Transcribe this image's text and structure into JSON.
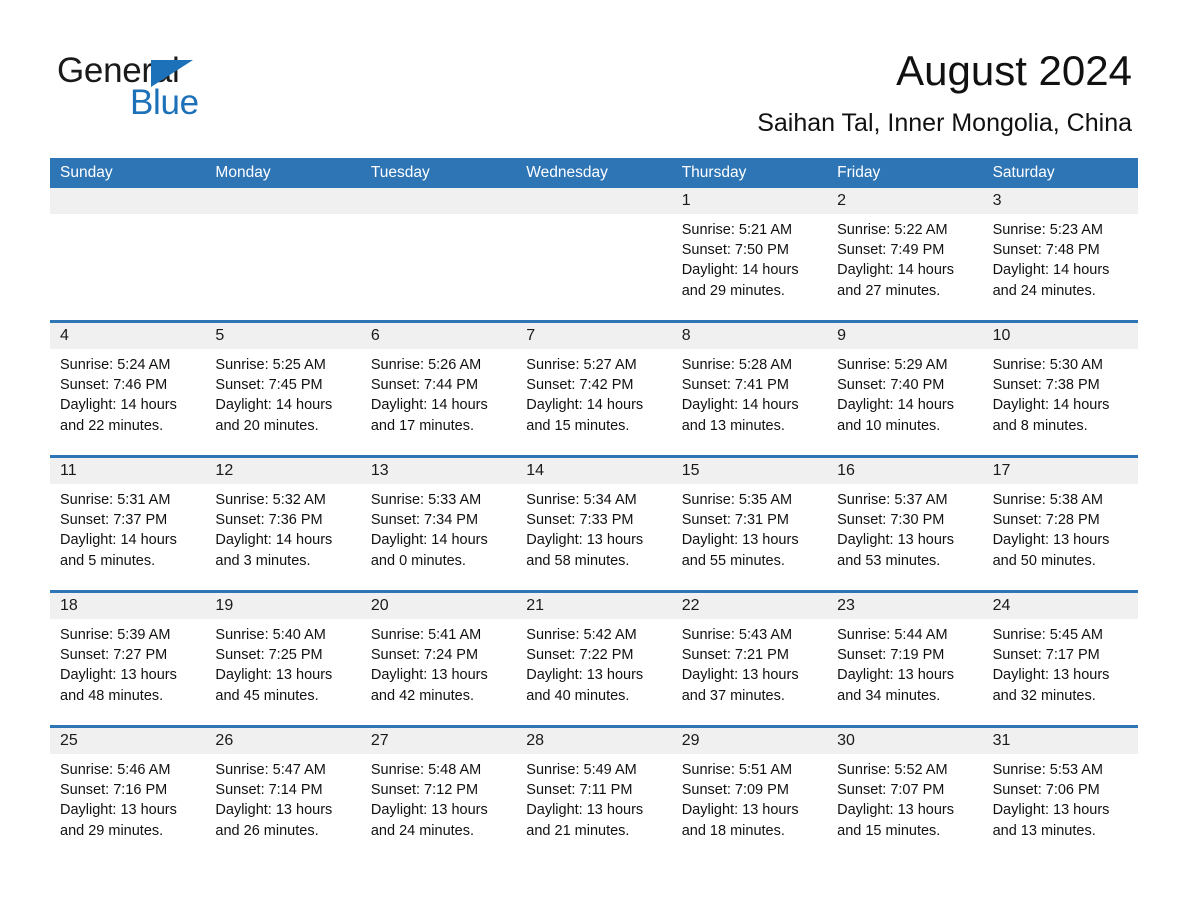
{
  "brand": {
    "name_part1": "General",
    "name_part2": "Blue",
    "triangle_color": "#1c71b8"
  },
  "header": {
    "month_title": "August 2024",
    "location": "Saihan Tal, Inner Mongolia, China"
  },
  "colors": {
    "header_blue": "#2e75b6",
    "day_band_gray": "#f0f0f0",
    "text": "#111111"
  },
  "weekdays": [
    "Sunday",
    "Monday",
    "Tuesday",
    "Wednesday",
    "Thursday",
    "Friday",
    "Saturday"
  ],
  "weeks": [
    [
      {
        "day": "",
        "lines": []
      },
      {
        "day": "",
        "lines": []
      },
      {
        "day": "",
        "lines": []
      },
      {
        "day": "",
        "lines": []
      },
      {
        "day": "1",
        "lines": [
          "Sunrise: 5:21 AM",
          "Sunset: 7:50 PM",
          "Daylight: 14 hours",
          "and 29 minutes."
        ]
      },
      {
        "day": "2",
        "lines": [
          "Sunrise: 5:22 AM",
          "Sunset: 7:49 PM",
          "Daylight: 14 hours",
          "and 27 minutes."
        ]
      },
      {
        "day": "3",
        "lines": [
          "Sunrise: 5:23 AM",
          "Sunset: 7:48 PM",
          "Daylight: 14 hours",
          "and 24 minutes."
        ]
      }
    ],
    [
      {
        "day": "4",
        "lines": [
          "Sunrise: 5:24 AM",
          "Sunset: 7:46 PM",
          "Daylight: 14 hours",
          "and 22 minutes."
        ]
      },
      {
        "day": "5",
        "lines": [
          "Sunrise: 5:25 AM",
          "Sunset: 7:45 PM",
          "Daylight: 14 hours",
          "and 20 minutes."
        ]
      },
      {
        "day": "6",
        "lines": [
          "Sunrise: 5:26 AM",
          "Sunset: 7:44 PM",
          "Daylight: 14 hours",
          "and 17 minutes."
        ]
      },
      {
        "day": "7",
        "lines": [
          "Sunrise: 5:27 AM",
          "Sunset: 7:42 PM",
          "Daylight: 14 hours",
          "and 15 minutes."
        ]
      },
      {
        "day": "8",
        "lines": [
          "Sunrise: 5:28 AM",
          "Sunset: 7:41 PM",
          "Daylight: 14 hours",
          "and 13 minutes."
        ]
      },
      {
        "day": "9",
        "lines": [
          "Sunrise: 5:29 AM",
          "Sunset: 7:40 PM",
          "Daylight: 14 hours",
          "and 10 minutes."
        ]
      },
      {
        "day": "10",
        "lines": [
          "Sunrise: 5:30 AM",
          "Sunset: 7:38 PM",
          "Daylight: 14 hours",
          "and 8 minutes."
        ]
      }
    ],
    [
      {
        "day": "11",
        "lines": [
          "Sunrise: 5:31 AM",
          "Sunset: 7:37 PM",
          "Daylight: 14 hours",
          "and 5 minutes."
        ]
      },
      {
        "day": "12",
        "lines": [
          "Sunrise: 5:32 AM",
          "Sunset: 7:36 PM",
          "Daylight: 14 hours",
          "and 3 minutes."
        ]
      },
      {
        "day": "13",
        "lines": [
          "Sunrise: 5:33 AM",
          "Sunset: 7:34 PM",
          "Daylight: 14 hours",
          "and 0 minutes."
        ]
      },
      {
        "day": "14",
        "lines": [
          "Sunrise: 5:34 AM",
          "Sunset: 7:33 PM",
          "Daylight: 13 hours",
          "and 58 minutes."
        ]
      },
      {
        "day": "15",
        "lines": [
          "Sunrise: 5:35 AM",
          "Sunset: 7:31 PM",
          "Daylight: 13 hours",
          "and 55 minutes."
        ]
      },
      {
        "day": "16",
        "lines": [
          "Sunrise: 5:37 AM",
          "Sunset: 7:30 PM",
          "Daylight: 13 hours",
          "and 53 minutes."
        ]
      },
      {
        "day": "17",
        "lines": [
          "Sunrise: 5:38 AM",
          "Sunset: 7:28 PM",
          "Daylight: 13 hours",
          "and 50 minutes."
        ]
      }
    ],
    [
      {
        "day": "18",
        "lines": [
          "Sunrise: 5:39 AM",
          "Sunset: 7:27 PM",
          "Daylight: 13 hours",
          "and 48 minutes."
        ]
      },
      {
        "day": "19",
        "lines": [
          "Sunrise: 5:40 AM",
          "Sunset: 7:25 PM",
          "Daylight: 13 hours",
          "and 45 minutes."
        ]
      },
      {
        "day": "20",
        "lines": [
          "Sunrise: 5:41 AM",
          "Sunset: 7:24 PM",
          "Daylight: 13 hours",
          "and 42 minutes."
        ]
      },
      {
        "day": "21",
        "lines": [
          "Sunrise: 5:42 AM",
          "Sunset: 7:22 PM",
          "Daylight: 13 hours",
          "and 40 minutes."
        ]
      },
      {
        "day": "22",
        "lines": [
          "Sunrise: 5:43 AM",
          "Sunset: 7:21 PM",
          "Daylight: 13 hours",
          "and 37 minutes."
        ]
      },
      {
        "day": "23",
        "lines": [
          "Sunrise: 5:44 AM",
          "Sunset: 7:19 PM",
          "Daylight: 13 hours",
          "and 34 minutes."
        ]
      },
      {
        "day": "24",
        "lines": [
          "Sunrise: 5:45 AM",
          "Sunset: 7:17 PM",
          "Daylight: 13 hours",
          "and 32 minutes."
        ]
      }
    ],
    [
      {
        "day": "25",
        "lines": [
          "Sunrise: 5:46 AM",
          "Sunset: 7:16 PM",
          "Daylight: 13 hours",
          "and 29 minutes."
        ]
      },
      {
        "day": "26",
        "lines": [
          "Sunrise: 5:47 AM",
          "Sunset: 7:14 PM",
          "Daylight: 13 hours",
          "and 26 minutes."
        ]
      },
      {
        "day": "27",
        "lines": [
          "Sunrise: 5:48 AM",
          "Sunset: 7:12 PM",
          "Daylight: 13 hours",
          "and 24 minutes."
        ]
      },
      {
        "day": "28",
        "lines": [
          "Sunrise: 5:49 AM",
          "Sunset: 7:11 PM",
          "Daylight: 13 hours",
          "and 21 minutes."
        ]
      },
      {
        "day": "29",
        "lines": [
          "Sunrise: 5:51 AM",
          "Sunset: 7:09 PM",
          "Daylight: 13 hours",
          "and 18 minutes."
        ]
      },
      {
        "day": "30",
        "lines": [
          "Sunrise: 5:52 AM",
          "Sunset: 7:07 PM",
          "Daylight: 13 hours",
          "and 15 minutes."
        ]
      },
      {
        "day": "31",
        "lines": [
          "Sunrise: 5:53 AM",
          "Sunset: 7:06 PM",
          "Daylight: 13 hours",
          "and 13 minutes."
        ]
      }
    ]
  ]
}
